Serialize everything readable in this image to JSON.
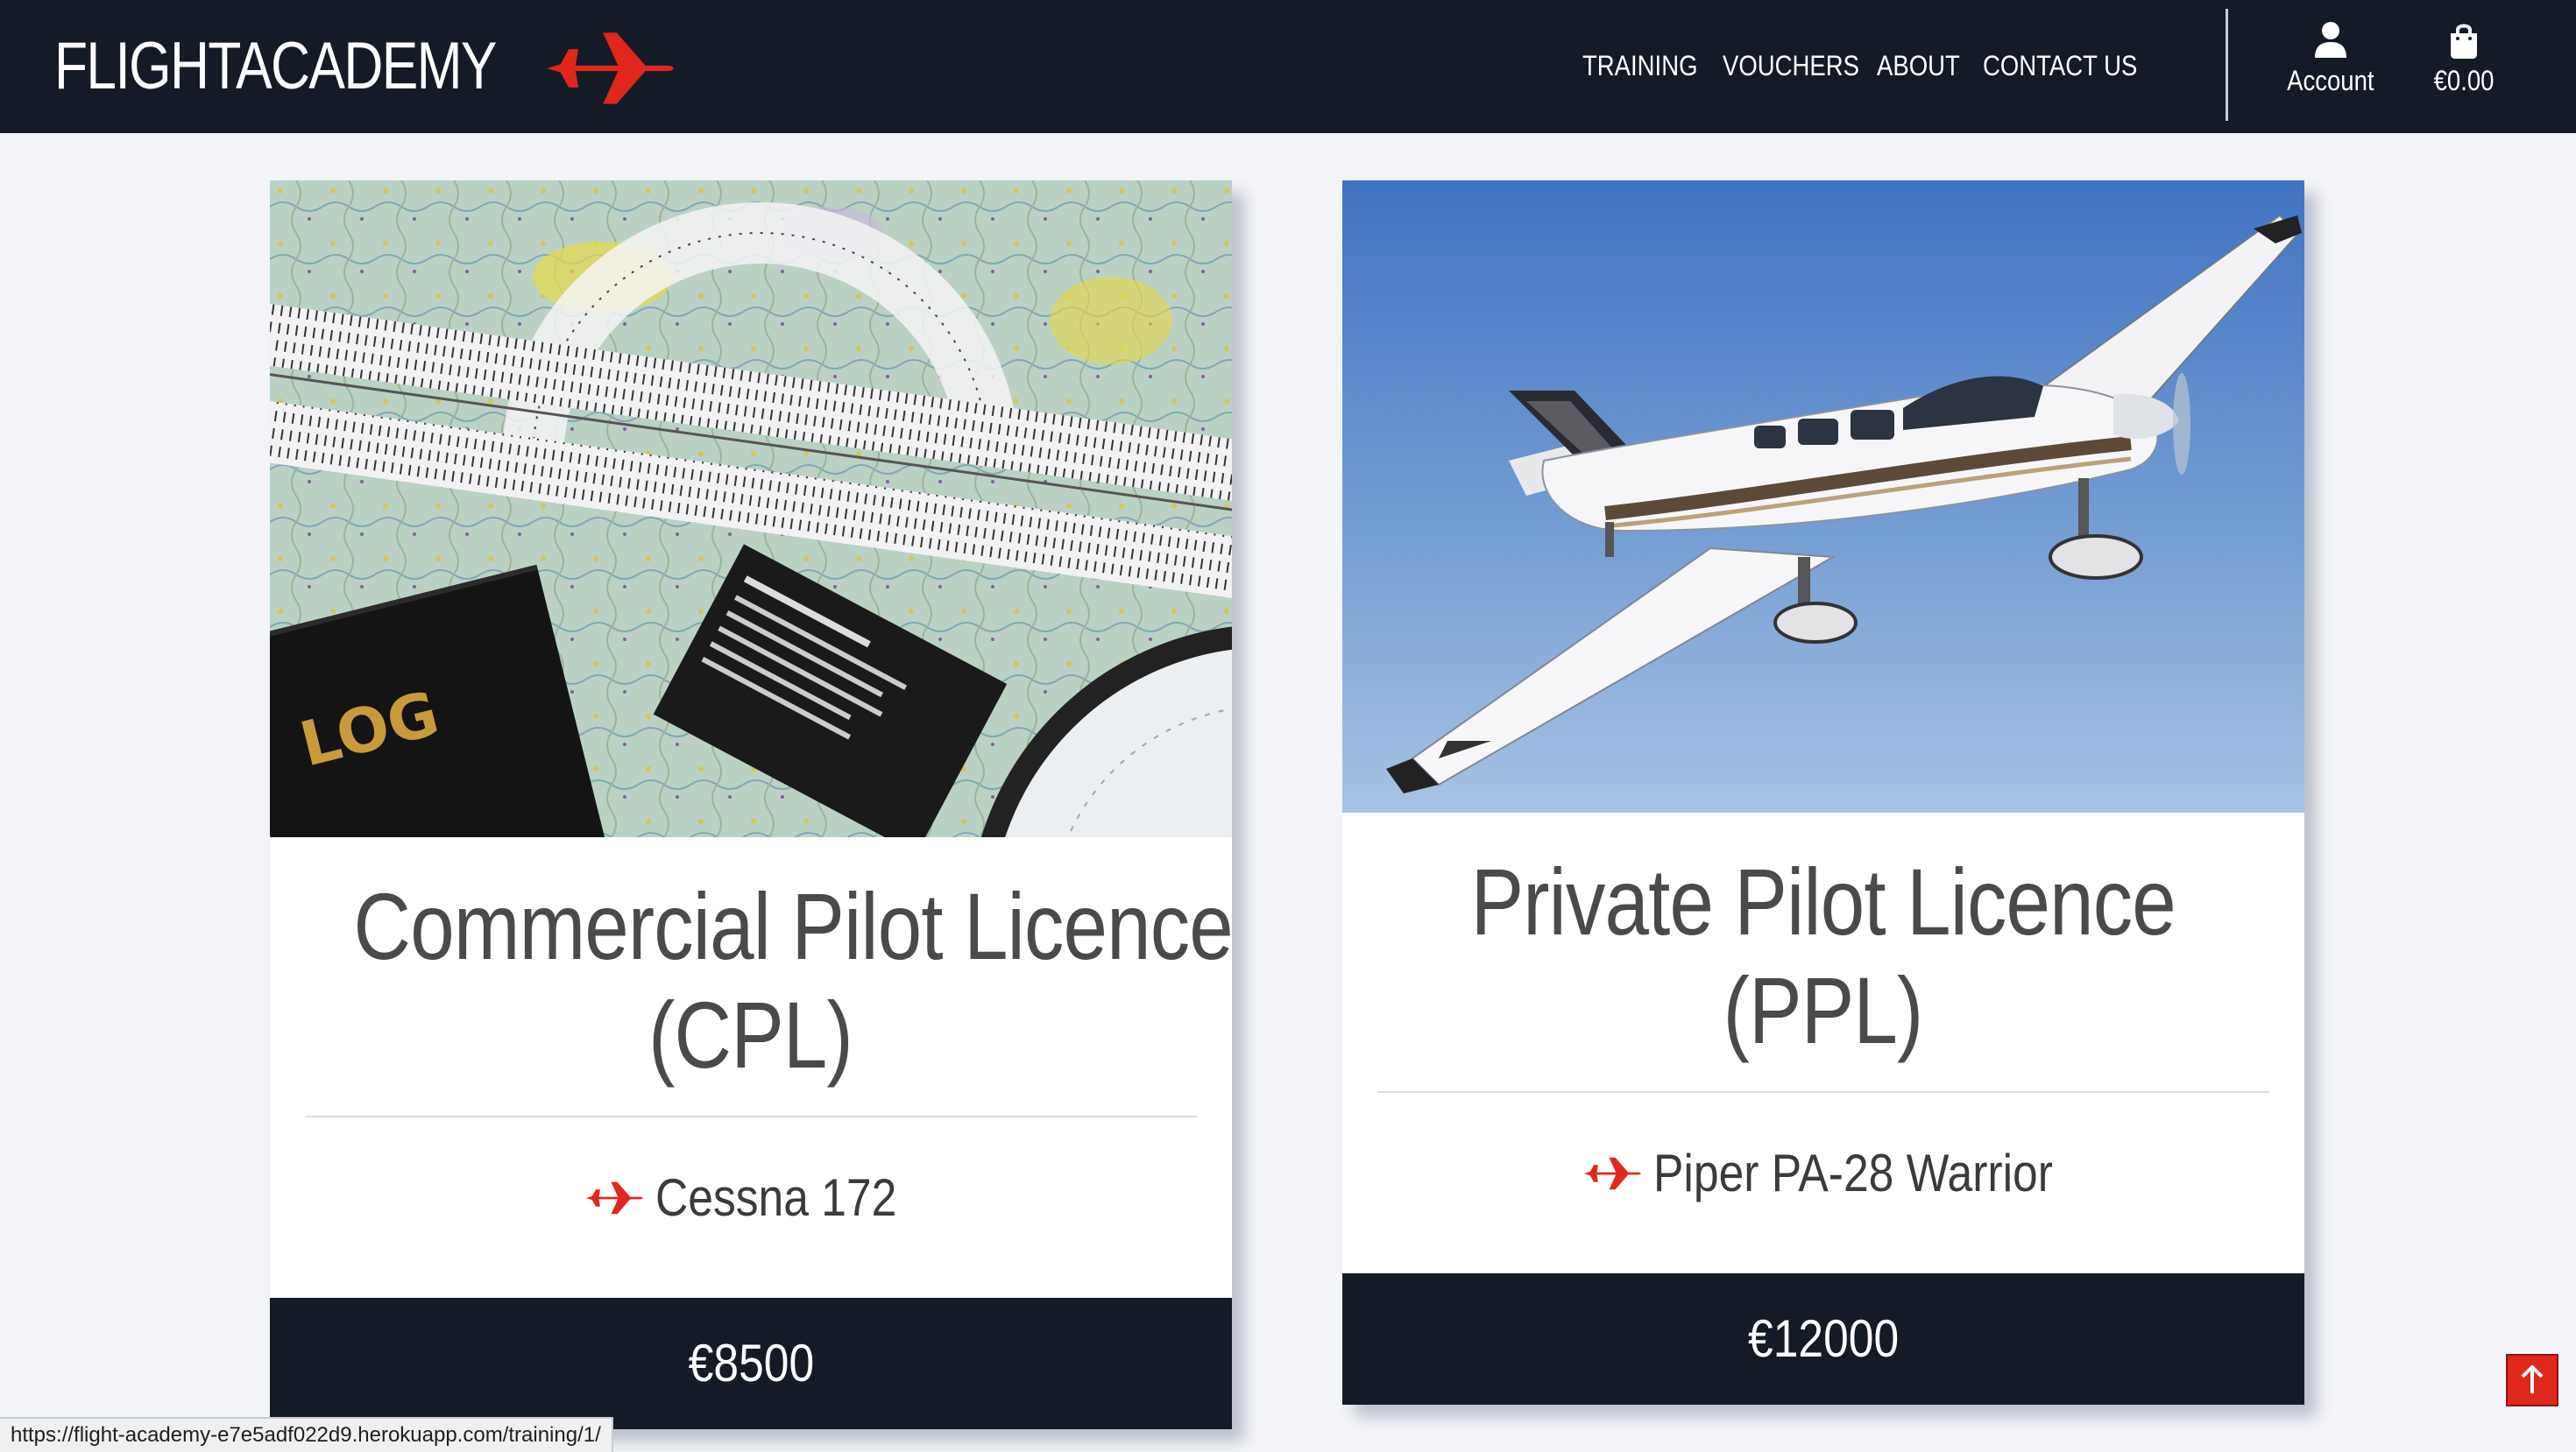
{
  "brand": {
    "name": "FLIGHTACADEMY",
    "logo_icon": "airplane-icon",
    "accent_color": "#e1261c"
  },
  "nav": {
    "links": [
      {
        "label": "TRAINING"
      },
      {
        "label": "VOUCHERS"
      },
      {
        "label": "ABOUT"
      },
      {
        "label": "CONTACT US"
      }
    ],
    "account": {
      "label": "Account",
      "icon": "user-icon"
    },
    "bag": {
      "label": "€0.00",
      "icon": "shopping-bag-icon"
    }
  },
  "trainings": [
    {
      "title_line1": "Commercial Pilot Licence",
      "title_line2": "(CPL)",
      "aircraft": "Cessna 172",
      "aircraft_icon": "airplane-icon",
      "price": "€8500",
      "image_label": "LOG"
    },
    {
      "title_line1": "Private Pilot Licence",
      "title_line2": "(PPL)",
      "aircraft": "Piper PA-28 Warrior",
      "aircraft_icon": "airplane-icon",
      "price": "€12000"
    }
  ],
  "scroll_top": {
    "icon": "arrow-up-icon"
  },
  "status_bar": {
    "url": "https://flight-academy-e7e5adf022d9.herokuapp.com/training/1/"
  },
  "colors": {
    "navbar": "#141b26",
    "page_background": "#f4f5f8",
    "accent": "#e1261c"
  }
}
